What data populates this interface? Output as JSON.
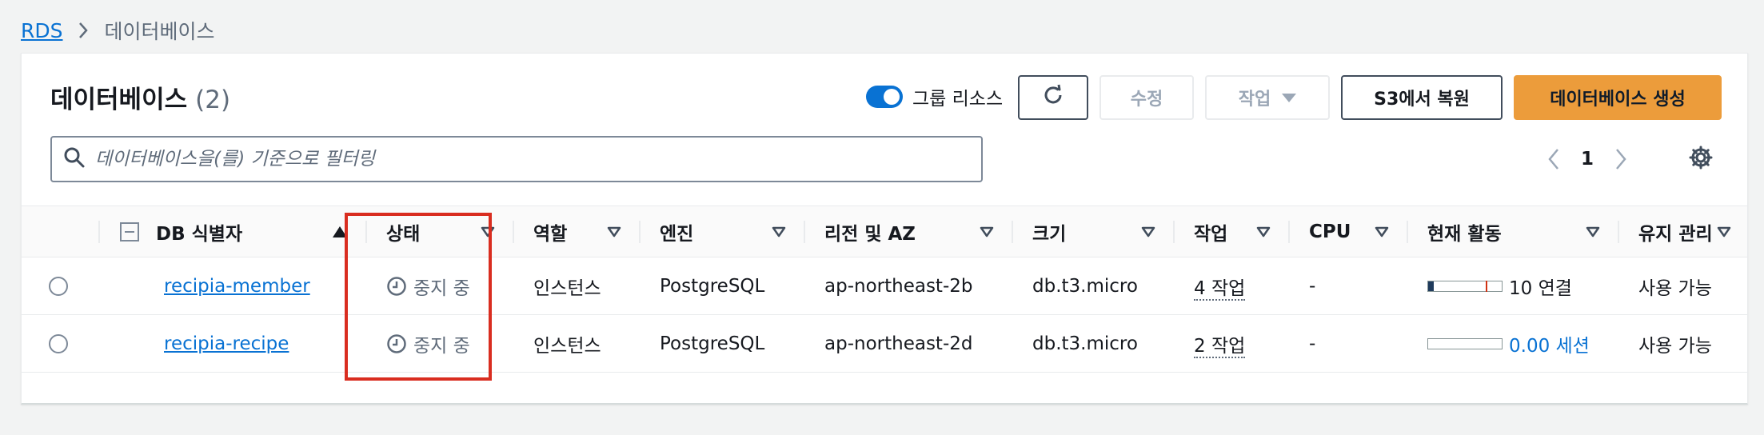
{
  "breadcrumb": {
    "root": "RDS",
    "current": "데이터베이스"
  },
  "panel": {
    "title": "데이터베이스",
    "count": "(2)"
  },
  "toolbar": {
    "group_toggle_label": "그룹 리소스",
    "refresh_icon": "refresh-icon",
    "modify_label": "수정",
    "actions_label": "작업",
    "restore_label": "S3에서 복원",
    "create_label": "데이터베이스 생성"
  },
  "search": {
    "placeholder": "데이터베이스을(를) 기준으로 필터링",
    "value": ""
  },
  "pagination": {
    "page": "1"
  },
  "table": {
    "headers": {
      "db_id": "DB 식별자",
      "status": "상태",
      "role": "역할",
      "engine": "엔진",
      "region": "리전 및 AZ",
      "size": "크기",
      "actions": "작업",
      "cpu": "CPU",
      "activity": "현재 활동",
      "maintenance": "유지 관리"
    },
    "rows": [
      {
        "db_id": "recipia-member",
        "status": "중지 중",
        "role": "인스턴스",
        "engine": "PostgreSQL",
        "region": "ap-northeast-2b",
        "size": "db.t3.micro",
        "actions": "4 작업",
        "cpu": "-",
        "activity": "10 연결",
        "activity_level": 0.08,
        "maintenance": "사용 가능"
      },
      {
        "db_id": "recipia-recipe",
        "status": "중지 중",
        "role": "인스턴스",
        "engine": "PostgreSQL",
        "region": "ap-northeast-2d",
        "size": "db.t3.micro",
        "actions": "2 작업",
        "cpu": "-",
        "activity": "0.00 세션",
        "activity_level": 0,
        "maintenance": "사용 가능"
      }
    ]
  },
  "colors": {
    "accent": "#0972d3",
    "primary_button": "#ec9c3b",
    "highlight": "#d92d20"
  }
}
